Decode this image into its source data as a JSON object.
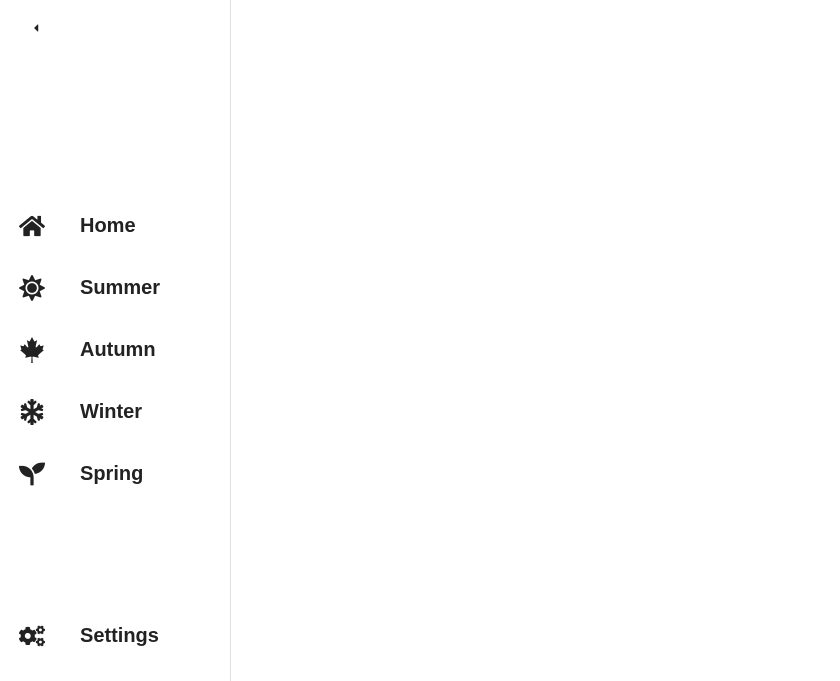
{
  "sidebar": {
    "items": [
      {
        "icon": "home-icon",
        "label": "Home"
      },
      {
        "icon": "sun-icon",
        "label": "Summer"
      },
      {
        "icon": "leaf-icon",
        "label": "Autumn"
      },
      {
        "icon": "snowflake-icon",
        "label": "Winter"
      },
      {
        "icon": "seedling-icon",
        "label": "Spring"
      }
    ],
    "footer": [
      {
        "icon": "cogs-icon",
        "label": "Settings"
      }
    ]
  }
}
